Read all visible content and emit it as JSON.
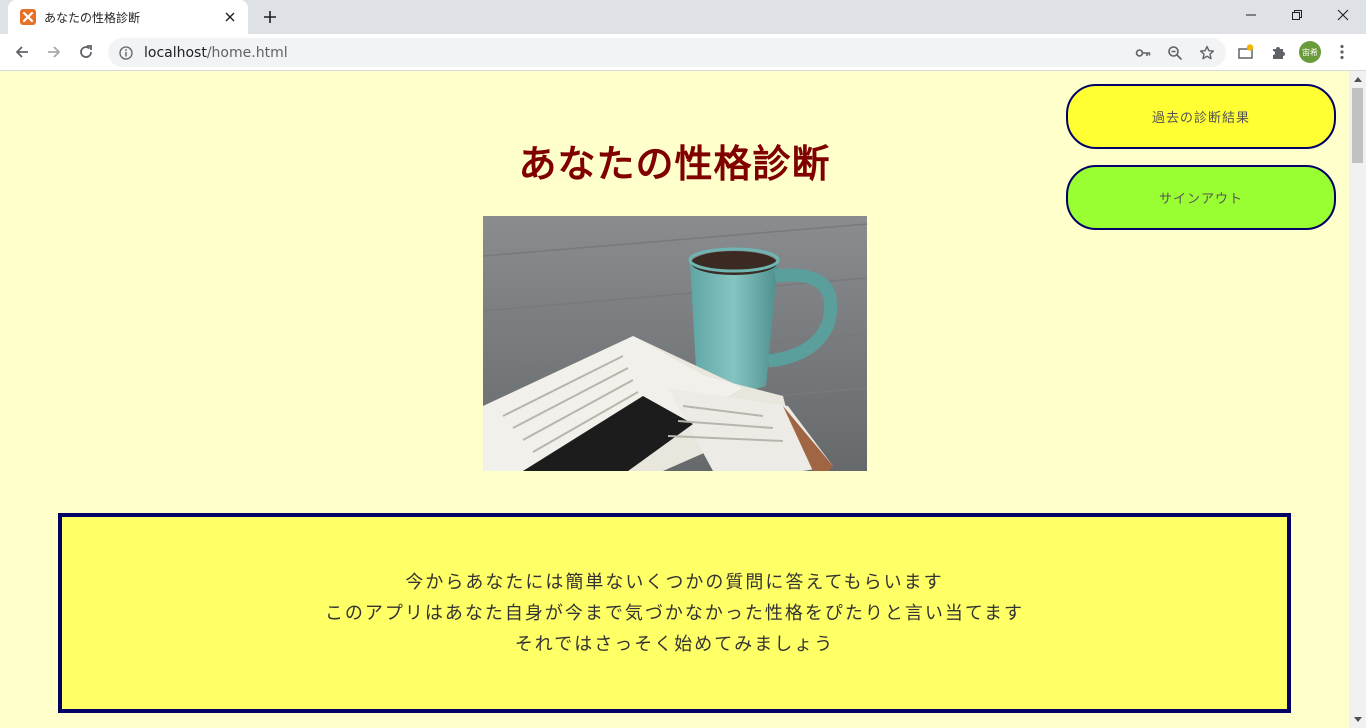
{
  "browser": {
    "tab": {
      "title": "あなたの性格診断",
      "favicon_letter": "ä"
    },
    "url": {
      "host": "localhost",
      "path": "/home.html"
    },
    "profile_initials": "宙希"
  },
  "page": {
    "title": "あなたの性格診断",
    "hero_image_alt": "coffee-and-book-photo",
    "buttons": {
      "history": "過去の診断結果",
      "signout": "サインアウト"
    },
    "intro": {
      "lines": [
        "今からあなたには簡単ないくつかの質問に答えてもらいます",
        "このアプリはあなた自身が今まで気づかなかった性格をぴたりと言い当てます",
        "それではさっそく始めてみましょう"
      ]
    }
  },
  "colors": {
    "page_background": "#ffffcc",
    "title": "#800000",
    "history_button": "#ffff33",
    "signout_button": "#99ff33",
    "intro_box": "#ffff66",
    "border": "#000066"
  }
}
